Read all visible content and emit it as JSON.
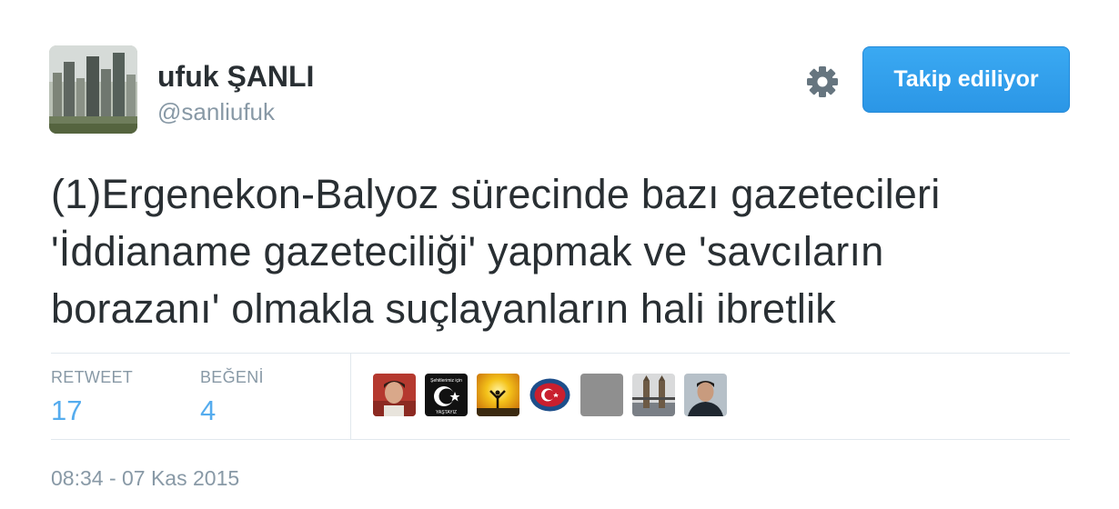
{
  "tweet": {
    "author": {
      "display_name": "ufuk ŞANLI",
      "handle": "@sanliufuk"
    },
    "follow_button_label": "Takip ediliyor",
    "text": "(1)Ergenekon-Balyoz sürecinde bazı gazetecileri\n'İddianame gazeteciliği' yapmak ve 'savcıların\nborazanı' olmakla suçlayanların hali ibretlik",
    "stats": {
      "retweet_label": "RETWEET",
      "retweet_count": "17",
      "like_label": "BEĞENİ",
      "like_count": "4"
    },
    "liker_avatars": [
      {
        "description": "avatar-person-red"
      },
      {
        "description": "avatar-crescent-star",
        "text_top": "Şehitlerimiz için",
        "text_bottom": "YAŞTAYIZ"
      },
      {
        "description": "avatar-sunset-silhouette"
      },
      {
        "description": "avatar-flag-globe"
      },
      {
        "description": "avatar-default-gray"
      },
      {
        "description": "avatar-bridge"
      },
      {
        "description": "avatar-person-dark"
      }
    ],
    "timestamp": "08:34 - 07 Kas 2015"
  },
  "colors": {
    "accent": "#55acee",
    "button": "#2b96e6",
    "text": "#292f33",
    "muted": "#8899a6",
    "divider": "#e1e8ed"
  }
}
